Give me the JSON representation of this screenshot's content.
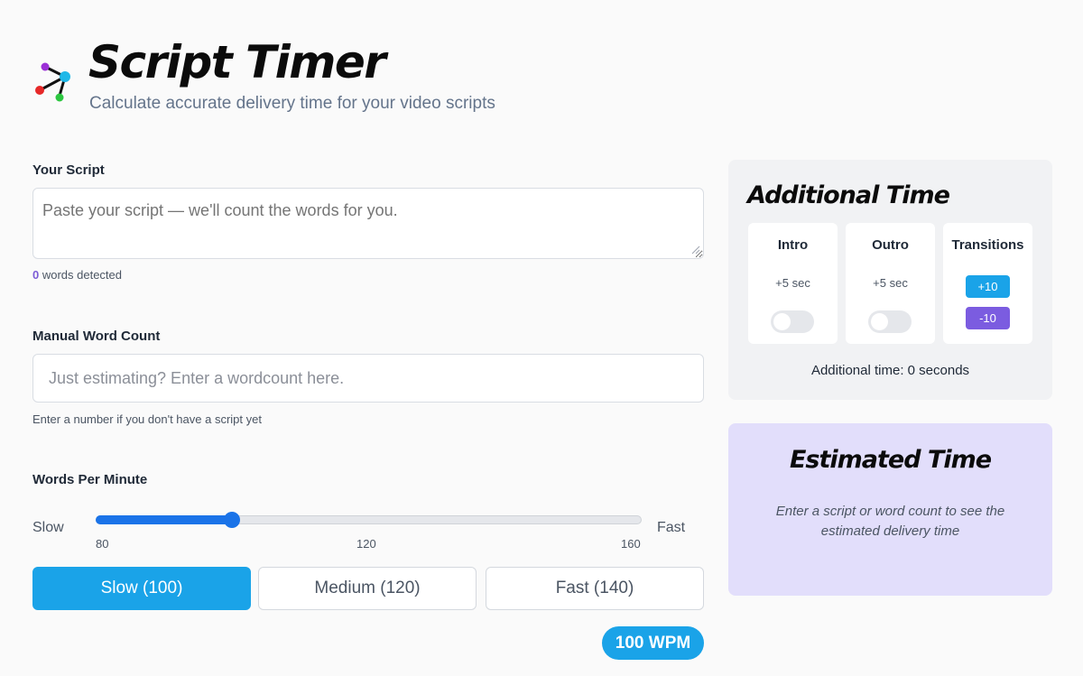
{
  "header": {
    "title": "Script Timer",
    "subtitle": "Calculate accurate delivery time for your video scripts"
  },
  "script": {
    "label": "Your Script",
    "placeholder": "Paste your script — we'll count the words for you.",
    "words_detected_count": "0",
    "words_detected_suffix": " words detected"
  },
  "manual": {
    "label": "Manual Word Count",
    "placeholder": "Just estimating? Enter a wordcount here.",
    "helper": "Enter a number if you don't have a script yet"
  },
  "wpm": {
    "label": "Words Per Minute",
    "slow_label": "Slow",
    "fast_label": "Fast",
    "min": 80,
    "max": 160,
    "value": 100,
    "ticks": [
      "80",
      "120",
      "160"
    ],
    "presets": [
      "Slow (100)",
      "Medium (120)",
      "Fast (140)"
    ],
    "active_preset": 0,
    "badge": "100 WPM"
  },
  "additional": {
    "title": "Additional Time",
    "intro_title": "Intro",
    "intro_sub": "+5 sec",
    "outro_title": "Outro",
    "outro_sub": "+5 sec",
    "transitions_title": "Transitions",
    "plus_label": "+10",
    "minus_label": "-10",
    "total": "Additional time: 0 seconds"
  },
  "estimate": {
    "title": "Estimated Time",
    "message_line1": "Enter a script or word count to see the",
    "message_line2": "estimated delivery time"
  },
  "colors": {
    "accent_blue": "#1aa3e8",
    "slider_blue": "#1a73e8",
    "purple": "#7c5cd6",
    "estimate_bg": "#e2defb"
  }
}
